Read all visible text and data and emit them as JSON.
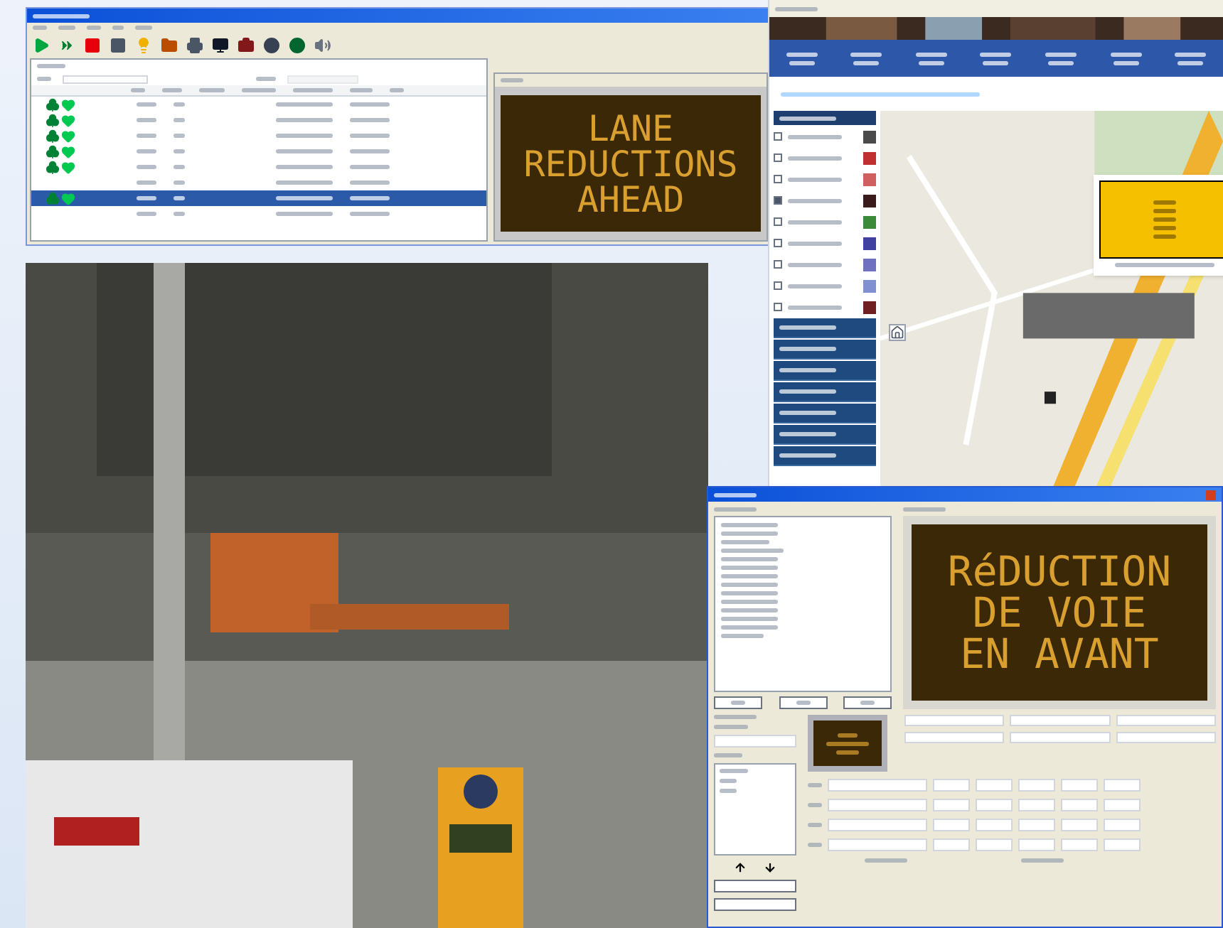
{
  "app_window": {
    "table": {
      "rows": [
        {
          "has_status": true,
          "selected": false
        },
        {
          "has_status": true,
          "selected": false
        },
        {
          "has_status": true,
          "selected": false
        },
        {
          "has_status": true,
          "selected": false
        },
        {
          "has_status": true,
          "selected": false
        },
        {
          "has_status": false,
          "selected": false
        },
        {
          "has_status": true,
          "selected": true
        },
        {
          "has_status": false,
          "selected": false
        }
      ]
    },
    "sign_preview": {
      "lines": [
        "LANE",
        "REDUCTIONS",
        "AHEAD"
      ]
    }
  },
  "map_window": {
    "layers": [
      {
        "checked": false,
        "color": "#4a4a4a"
      },
      {
        "checked": false,
        "color": "#c03030"
      },
      {
        "checked": false,
        "color": "#d06060"
      },
      {
        "checked": true,
        "color": "#3a1a1a"
      },
      {
        "checked": false,
        "color": "#3a8a3a"
      },
      {
        "checked": false,
        "color": "#4040a0"
      },
      {
        "checked": false,
        "color": "#7070c0"
      },
      {
        "checked": false,
        "color": "#8090d0"
      },
      {
        "checked": false,
        "color": "#702020"
      }
    ]
  },
  "editor_window": {
    "sign_preview": {
      "lines": [
        "RéDUCTION",
        "DE VOIE",
        "EN AVANT"
      ]
    }
  }
}
